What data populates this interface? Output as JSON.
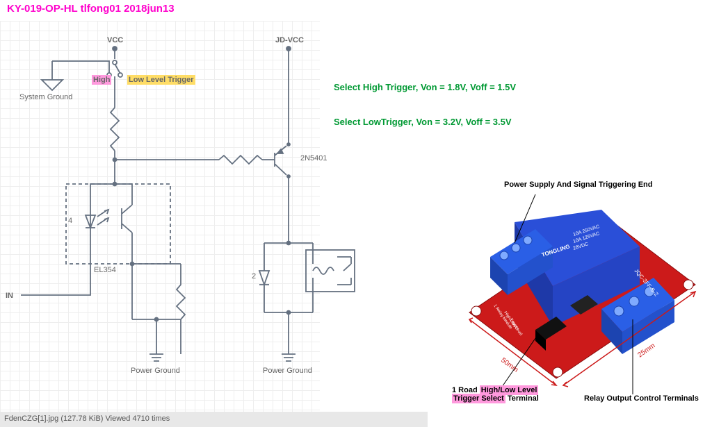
{
  "title": "KY-019-OP-HL tlfong01 2018jun13",
  "labels": {
    "vcc": "VCC",
    "jdvcc": "JD-VCC",
    "system_ground": "System Ground",
    "high": "High",
    "low_level_trigger": "Low Level Trigger",
    "in": "IN",
    "opto": "EL354",
    "transistor": "2N5401",
    "power_ground1": "Power Ground",
    "power_ground2": "Power Ground",
    "pin4": "4",
    "pin2": "2"
  },
  "info": {
    "high_trigger": "Select High Trigger, Von = 1.8V, Voff = 1.5V",
    "low_trigger": "Select LowTrigger, Von = 3.2V, Voff = 3.5V"
  },
  "photo": {
    "header1": "Power Supply And Signal Triggering End",
    "dim1": "50mm",
    "dim2": "25mm",
    "footer_left_1": "1 Road",
    "footer_left_hl": "High/Low Level",
    "footer_left_2": "Trigger Select",
    "footer_left_3": "Terminal",
    "footer_right": "Relay Output Control Terminals"
  },
  "relay_text": {
    "line1": "10A 250VAC",
    "line2": "10A 125VAC",
    "line3": "28VDC",
    "brand": "TONGLING",
    "model": "JQC-3FF-S-Z"
  },
  "pcb_text": {
    "t1": "1 Relay Module",
    "t2": "High/Low Level",
    "t3": "Trigger"
  },
  "footer": "FdenCZG[1].jpg (127.78 KiB) Viewed 4710 times"
}
